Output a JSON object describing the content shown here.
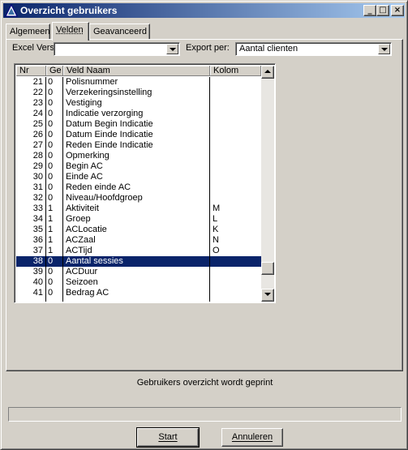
{
  "window": {
    "title": "Overzicht gebruikers"
  },
  "titlebar_buttons": {
    "minimize": "_",
    "maximize": "□",
    "close": "×"
  },
  "tabs": [
    {
      "label": "Algemeen",
      "active": false
    },
    {
      "label": "Velden",
      "active": true
    },
    {
      "label": "Geavanceerd",
      "active": false
    }
  ],
  "excel_version": {
    "label": "Excel Versie:",
    "value": ""
  },
  "export_per": {
    "label": "Export per:",
    "value": "Aantal clienten"
  },
  "grid": {
    "columns": [
      "Nr",
      "Ge",
      "Veld Naam",
      "Kolom"
    ],
    "rows": [
      {
        "nr": "21",
        "ge": "0",
        "naam": "Polisnummer",
        "kolom": ""
      },
      {
        "nr": "22",
        "ge": "0",
        "naam": "Verzekeringsinstelling",
        "kolom": ""
      },
      {
        "nr": "23",
        "ge": "0",
        "naam": "Vestiging",
        "kolom": ""
      },
      {
        "nr": "24",
        "ge": "0",
        "naam": "Indicatie verzorging",
        "kolom": ""
      },
      {
        "nr": "25",
        "ge": "0",
        "naam": "Datum Begin Indicatie",
        "kolom": ""
      },
      {
        "nr": "26",
        "ge": "0",
        "naam": "Datum Einde Indicatie",
        "kolom": ""
      },
      {
        "nr": "27",
        "ge": "0",
        "naam": "Reden Einde Indicatie",
        "kolom": ""
      },
      {
        "nr": "28",
        "ge": "0",
        "naam": "Opmerking",
        "kolom": ""
      },
      {
        "nr": "29",
        "ge": "0",
        "naam": "Begin AC",
        "kolom": ""
      },
      {
        "nr": "30",
        "ge": "0",
        "naam": "Einde AC",
        "kolom": ""
      },
      {
        "nr": "31",
        "ge": "0",
        "naam": "Reden einde AC",
        "kolom": ""
      },
      {
        "nr": "32",
        "ge": "0",
        "naam": "Niveau/Hoofdgroep",
        "kolom": ""
      },
      {
        "nr": "33",
        "ge": "1",
        "naam": "Aktiviteit",
        "kolom": "M"
      },
      {
        "nr": "34",
        "ge": "1",
        "naam": "Groep",
        "kolom": "L"
      },
      {
        "nr": "35",
        "ge": "1",
        "naam": "ACLocatie",
        "kolom": "K"
      },
      {
        "nr": "36",
        "ge": "1",
        "naam": "ACZaal",
        "kolom": "N"
      },
      {
        "nr": "37",
        "ge": "1",
        "naam": "ACTijd",
        "kolom": "O"
      },
      {
        "nr": "38",
        "ge": "0",
        "naam": "Aantal sessies",
        "kolom": "",
        "selected": true
      },
      {
        "nr": "39",
        "ge": "0",
        "naam": "ACDuur",
        "kolom": ""
      },
      {
        "nr": "40",
        "ge": "0",
        "naam": "Seizoen",
        "kolom": ""
      },
      {
        "nr": "41",
        "ge": "0",
        "naam": "Bedrag AC",
        "kolom": ""
      }
    ],
    "scroll_position": 0.93
  },
  "status": {
    "text": "Gebruikers overzicht wordt geprint"
  },
  "progress": {
    "value": 0
  },
  "buttons": {
    "start": "Start",
    "annuleren": "Annuleren"
  },
  "colors": {
    "selection": "#0a246a",
    "titlebar_start": "#0a246a",
    "titlebar_end": "#a6caf0",
    "face": "#d4d0c8"
  }
}
